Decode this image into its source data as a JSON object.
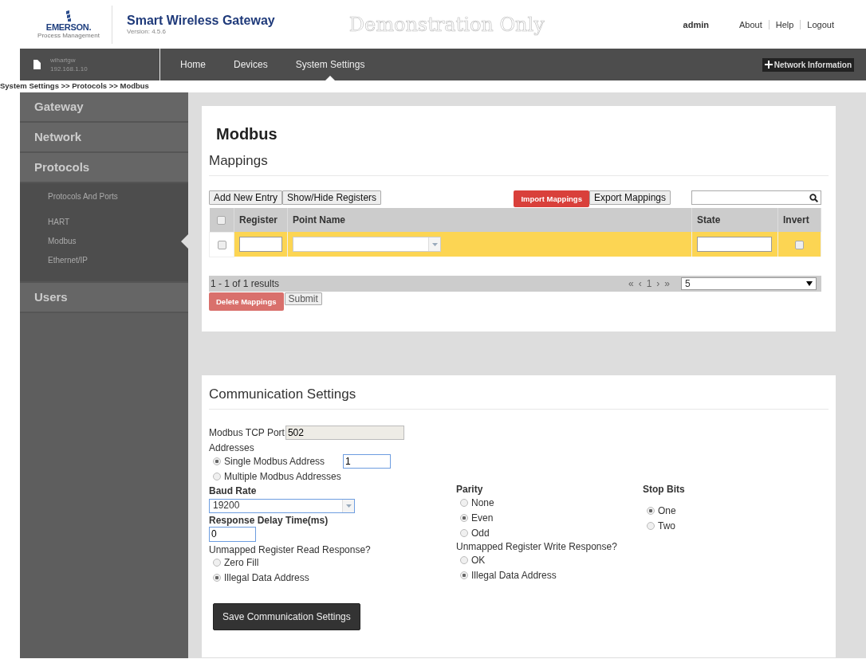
{
  "header": {
    "brand": "EMERSON.",
    "brand_sub": "Process Management",
    "title": "Smart Wireless Gateway",
    "version": "Version: 4.5.6",
    "demo_label": "Demonstration Only",
    "user": "admin",
    "links": [
      "About",
      "Help",
      "Logout"
    ]
  },
  "navbar": {
    "host": "wihartgw",
    "ip": "192.168.1.10",
    "tabs": [
      {
        "label": "Home",
        "selected": false
      },
      {
        "label": "Devices",
        "selected": false
      },
      {
        "label": "System Settings",
        "selected": true
      }
    ],
    "network_button": "Network Information"
  },
  "breadcrumb": "System Settings >> Protocols >> Modbus",
  "sidebar": {
    "items": [
      {
        "label": "Gateway",
        "expanded": false
      },
      {
        "label": "Network",
        "expanded": false
      },
      {
        "label": "Protocols",
        "expanded": true,
        "children": [
          {
            "label": "Protocols And Ports",
            "selected": false
          },
          {
            "label": "HART",
            "selected": false
          },
          {
            "label": "Modbus",
            "selected": true
          },
          {
            "label": "Ethernet/IP",
            "selected": false
          }
        ]
      },
      {
        "label": "Users",
        "expanded": false
      }
    ]
  },
  "page_title": "Modbus",
  "mappings": {
    "title": "Mappings",
    "buttons": [
      "Add New Entry",
      "Show/Hide Registers"
    ],
    "import_button": "Import Mappings",
    "export_button": "Export Mappings",
    "columns": [
      "Register",
      "Point Name",
      "State",
      "Invert"
    ],
    "header_checked": false,
    "rows": [
      {
        "checked": false,
        "invert": false
      }
    ],
    "results": "1 - 1 of 1 results",
    "pager": [
      "«",
      "‹",
      "1",
      "›",
      "»"
    ],
    "page_size": "5",
    "delete_button": "Delete Mappings",
    "submit_button": "Submit"
  },
  "communication": {
    "title": "Communication Settings",
    "tcp_port_label": "Modbus TCP Port",
    "tcp_port": "502",
    "addresses_label": "Addresses",
    "addresses": [
      {
        "label": "Single Modbus Address",
        "selected": true
      },
      {
        "label": "Multiple Modbus Addresses",
        "selected": false
      }
    ],
    "single_address": "1",
    "baud_label": "Baud Rate",
    "baud": "19200",
    "delay_label": "Response Delay Time(ms)",
    "delay": "0",
    "read_label": "Unmapped Register Read Response?",
    "read_options": [
      {
        "label": "Zero Fill",
        "selected": false
      },
      {
        "label": "Illegal Data Address",
        "selected": true
      }
    ],
    "parity_label": "Parity",
    "parity": [
      {
        "label": "None",
        "selected": false
      },
      {
        "label": "Even",
        "selected": true
      },
      {
        "label": "Odd",
        "selected": false
      }
    ],
    "write_label": "Unmapped Register Write Response?",
    "write_options": [
      {
        "label": "OK",
        "selected": false
      },
      {
        "label": "Illegal Data Address",
        "selected": true
      }
    ],
    "stop_label": "Stop Bits",
    "stop_bits": [
      {
        "label": "One",
        "selected": true
      },
      {
        "label": "Two",
        "selected": false
      }
    ],
    "save_button": "Save Communication Settings"
  }
}
